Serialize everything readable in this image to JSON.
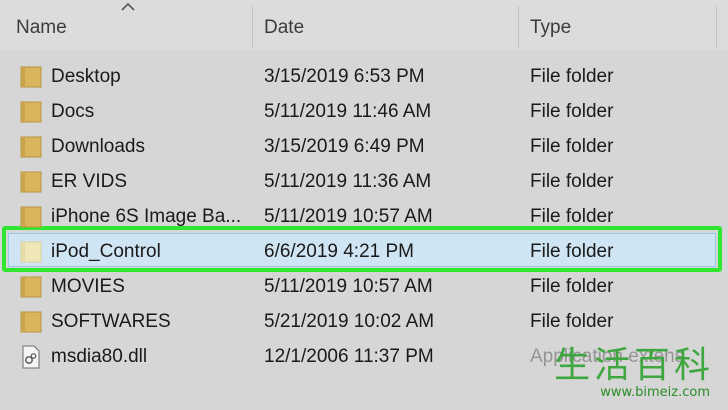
{
  "columns": {
    "name": "Name",
    "date": "Date",
    "type": "Type"
  },
  "rows": [
    {
      "name": "Desktop",
      "date": "3/15/2019 6:53 PM",
      "type": "File folder",
      "icon": "folder-icon"
    },
    {
      "name": "Docs",
      "date": "5/11/2019 11:46 AM",
      "type": "File folder",
      "icon": "folder-icon"
    },
    {
      "name": "Downloads",
      "date": "3/15/2019 6:49 PM",
      "type": "File folder",
      "icon": "folder-icon"
    },
    {
      "name": "ER VIDS",
      "date": "5/11/2019 11:36 AM",
      "type": "File folder",
      "icon": "folder-icon"
    },
    {
      "name": "iPhone 6S Image Ba...",
      "date": "5/11/2019 10:57 AM",
      "type": "File folder",
      "icon": "folder-icon"
    },
    {
      "name": "iPod_Control",
      "date": "6/6/2019 4:21 PM",
      "type": "File folder",
      "icon": "folder-icon",
      "selected": true
    },
    {
      "name": "MOVIES",
      "date": "5/11/2019 10:57 AM",
      "type": "File folder",
      "icon": "folder-icon"
    },
    {
      "name": "SOFTWARES",
      "date": "5/21/2019 10:02 AM",
      "type": "File folder",
      "icon": "folder-icon"
    },
    {
      "name": "msdia80.dll",
      "date": "12/1/2006 11:37 PM",
      "type": "Application extens",
      "icon": "dll-file-icon"
    }
  ],
  "watermark": {
    "chars": "生活百科",
    "url": "www.bimeiz.com"
  },
  "colors": {
    "highlight": "#2ee72e",
    "selection": "#cde6f7",
    "folder": "#d9b65c"
  }
}
